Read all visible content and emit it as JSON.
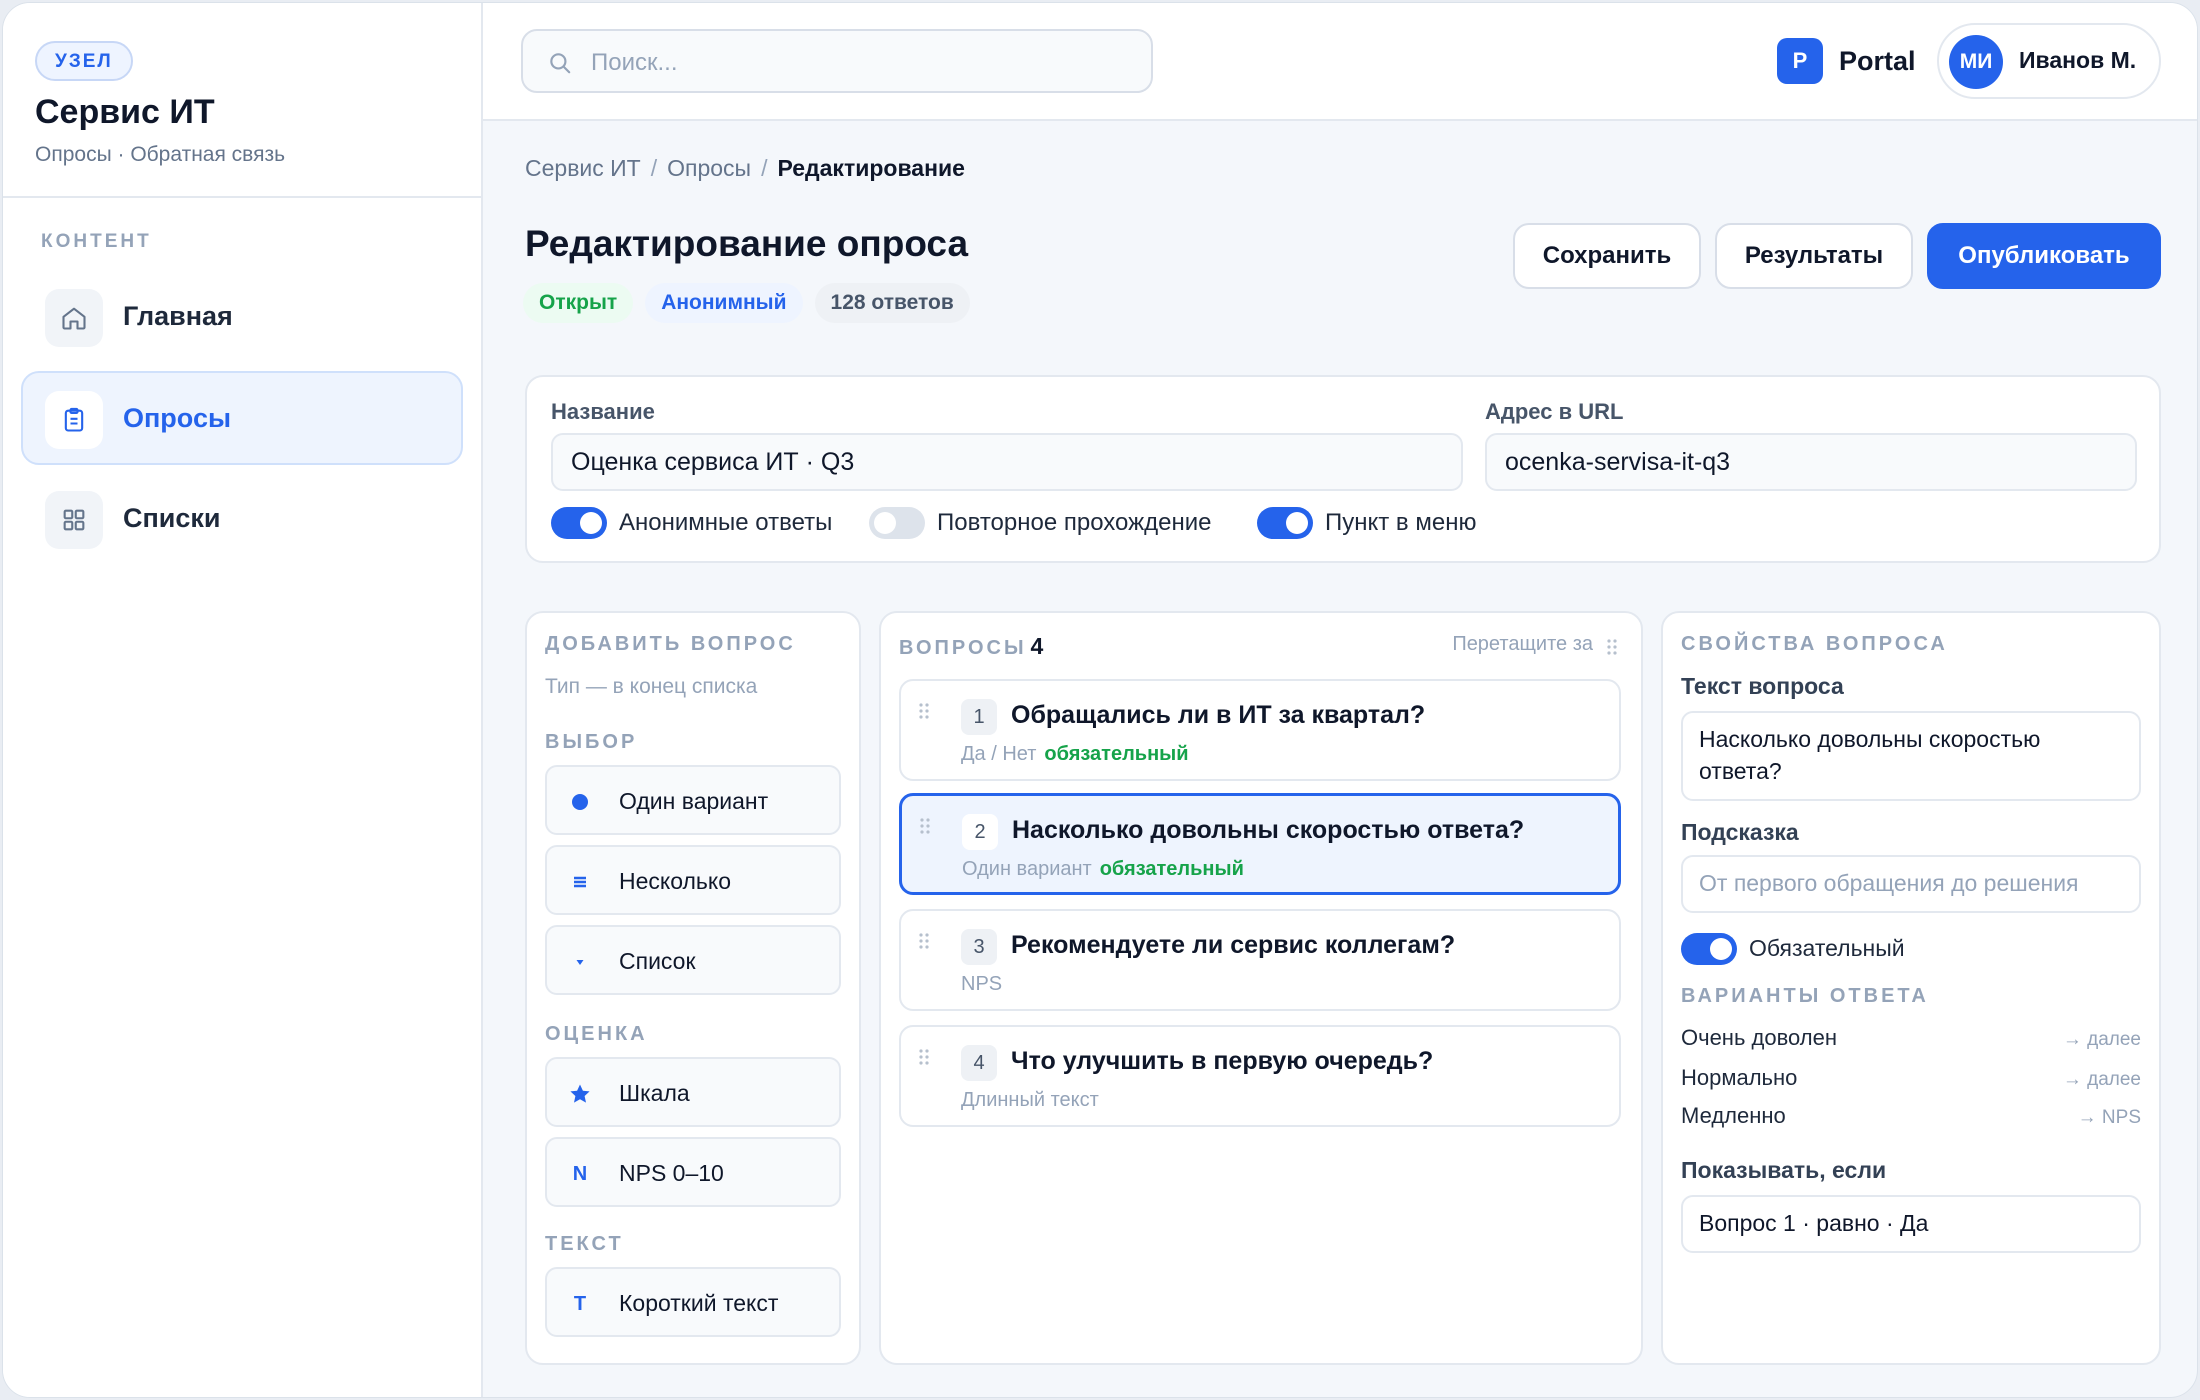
{
  "sidebar": {
    "badge": "УЗЕЛ",
    "title": "Сервис ИТ",
    "subtitle": "Опросы · Обратная связь",
    "section": "КОНТЕНТ",
    "items": [
      {
        "label": "Главная",
        "icon": "home-icon",
        "active": false
      },
      {
        "label": "Опросы",
        "icon": "clipboard-icon",
        "active": true
      },
      {
        "label": "Списки",
        "icon": "grid-icon",
        "active": false
      }
    ]
  },
  "topbar": {
    "search_placeholder": "Поиск...",
    "portal_letter": "P",
    "portal_name": "Portal",
    "user_initials": "МИ",
    "user_name": "Иванов М."
  },
  "breadcrumb": [
    "Сервис ИТ",
    "Опросы",
    "Редактирование"
  ],
  "page": {
    "title": "Редактирование опроса",
    "status": [
      "Открыт",
      "Анонимный",
      "128 ответов"
    ],
    "actions": {
      "save": "Сохранить",
      "results": "Результаты",
      "publish": "Опубликовать"
    }
  },
  "settings": {
    "name_label": "Название",
    "name_value": "Оценка сервиса ИТ · Q3",
    "url_label": "Адрес в URL",
    "url_value": "ocenka-servisa-it-q3",
    "toggles": [
      {
        "label": "Анонимные ответы",
        "on": true
      },
      {
        "label": "Повторное прохождение",
        "on": false
      },
      {
        "label": "Пункт в меню",
        "on": true
      }
    ]
  },
  "add_question": {
    "title": "ДОБАВИТЬ ВОПРОС",
    "hint": "Тип — в конец списка",
    "groups": [
      {
        "label": "ВЫБОР",
        "types": [
          {
            "label": "Один вариант",
            "icon": "radio-dot-icon"
          },
          {
            "label": "Несколько",
            "icon": "list-lines-icon"
          },
          {
            "label": "Список",
            "icon": "caret-down-icon"
          }
        ]
      },
      {
        "label": "ОЦЕНКА",
        "types": [
          {
            "label": "Шкала",
            "icon": "star-icon"
          },
          {
            "label": "NPS 0–10",
            "icon": "letter-n-icon",
            "glyph": "N"
          }
        ]
      },
      {
        "label": "ТЕКСТ",
        "types": [
          {
            "label": "Короткий текст",
            "icon": "letter-t-icon",
            "glyph": "T"
          }
        ]
      }
    ]
  },
  "questions": {
    "title": "ВОПРОСЫ",
    "count": "4",
    "drag_hint": "Перетащите за",
    "items": [
      {
        "num": "1",
        "text": "Обращались ли в ИТ за квартал?",
        "type": "Да / Нет",
        "required": "обязательный",
        "selected": false
      },
      {
        "num": "2",
        "text": "Насколько довольны скоростью ответа?",
        "type": "Один вариант",
        "required": "обязательный",
        "selected": true
      },
      {
        "num": "3",
        "text": "Рекомендуете ли сервис коллегам?",
        "type": "NPS",
        "required": "",
        "selected": false
      },
      {
        "num": "4",
        "text": "Что улучшить в первую очередь?",
        "type": "Длинный текст",
        "required": "",
        "selected": false
      }
    ]
  },
  "properties": {
    "title": "СВОЙСТВА ВОПРОСА",
    "text_label": "Текст вопроса",
    "text_value": "Насколько довольны скоростью ответа?",
    "hint_label": "Подсказка",
    "hint_placeholder": "От первого обращения до решения",
    "required_label": "Обязательный",
    "options_title": "ВАРИАНТЫ ОТВЕТА",
    "options": [
      {
        "label": "Очень доволен",
        "action": "→ далее"
      },
      {
        "label": "Нормально",
        "action": "→ далее"
      },
      {
        "label": "Медленно",
        "action": "→ NPS"
      }
    ],
    "condition_label": "Показывать, если",
    "condition_value": "Вопрос 1 · равно · Да"
  },
  "colors": {
    "accent": "#2563eb",
    "success": "#16a34a",
    "muted": "#94a3b8"
  }
}
